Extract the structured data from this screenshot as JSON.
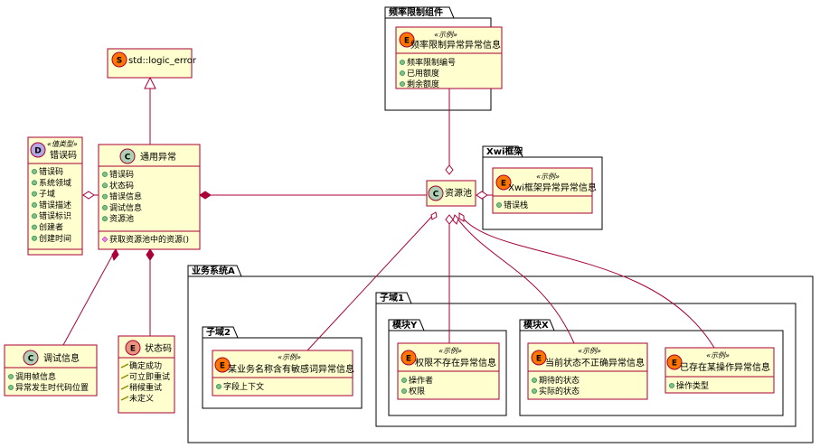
{
  "packages": {
    "rate_limit": "频率限制组件",
    "xwi": "Xwi框架",
    "system_a": "业务系统A",
    "domain1": "子域1",
    "domain2": "子域2",
    "module_y": "模块Y",
    "module_x": "模块X"
  },
  "classes": {
    "logic_error": {
      "kind": "S",
      "name": "std::logic_error"
    },
    "error_code": {
      "kind": "D",
      "stereotype": "«值类型»",
      "name": "错误码",
      "fields": [
        "错误码",
        "系统领域",
        "子域",
        "错误描述",
        "错误标识",
        "创建者",
        "创建时间"
      ]
    },
    "general_exception": {
      "kind": "C",
      "name": "通用异常",
      "fields": [
        "错误码",
        "状态码",
        "错误信息",
        "调试信息",
        "资源池"
      ],
      "methods": [
        "获取资源池中的资源()"
      ]
    },
    "resource_pool": {
      "kind": "C",
      "name": "资源池"
    },
    "debug_info": {
      "kind": "C",
      "name": "调试信息",
      "fields": [
        "调用帧信息",
        "异常发生时代码位置"
      ]
    },
    "status_code": {
      "kind": "E",
      "name": "状态码",
      "literals": [
        "确定成功",
        "可立即重试",
        "稍候重试",
        "未定义"
      ]
    },
    "rate_limit_exc": {
      "kind": "E",
      "stereotype": "«示例»",
      "name": "频率限制异常异常信息",
      "fields": [
        "频率限制编号",
        "已用额度",
        "剩余额度"
      ]
    },
    "xwi_exc": {
      "kind": "E",
      "stereotype": "«示例»",
      "name": "Xwi框架异常异常信息",
      "fields": [
        "错误栈"
      ]
    },
    "sensitive_exc": {
      "kind": "E",
      "stereotype": "«示例»",
      "name": "某业务名称含有敏感词异常信息",
      "fields": [
        "字段上下文"
      ]
    },
    "permission_exc": {
      "kind": "E",
      "stereotype": "«示例»",
      "name": "权限不存在异常信息",
      "fields": [
        "操作者",
        "权限"
      ]
    },
    "state_exc": {
      "kind": "E",
      "stereotype": "«示例»",
      "name": "当前状态不正确异常信息",
      "fields": [
        "期待的状态",
        "实际的状态"
      ]
    },
    "exists_exc": {
      "kind": "E",
      "stereotype": "«示例»",
      "name": "已存在某操作异常信息",
      "fields": [
        "操作类型"
      ]
    }
  },
  "colors": {
    "class_fill": "#FEFECE",
    "border": "#A80036",
    "line": "#A80036",
    "package_fill": "#FFFFFF",
    "badge_S": "#FF7700",
    "badge_D": "#B4A7E5",
    "badge_C": "#ADD1B2",
    "badge_E": "#EB937F",
    "field_icon": "#84BE84",
    "method_icon": "#EE82EE"
  }
}
